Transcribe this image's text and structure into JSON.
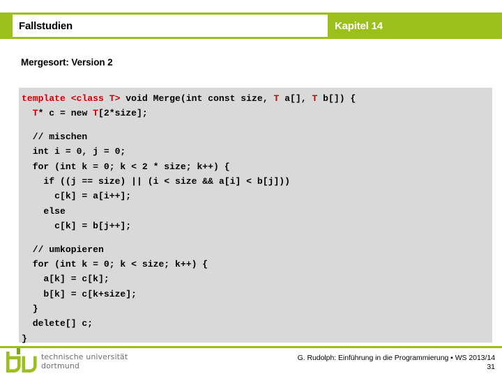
{
  "theme": {
    "accent_green": "#9BC01C",
    "code_background": "#D9D9D9",
    "keyword_red": "#D00000",
    "text_black": "#000000",
    "logo_gray": "#6E6E6E"
  },
  "header": {
    "title": "Fallstudien",
    "chapter": "Kapitel 14"
  },
  "subtitle": "Mergesort: Version 2",
  "code": {
    "lines": [
      [
        {
          "t": "template <class T>",
          "k": true
        },
        {
          "t": " void Merge(int const size, ",
          "k": false
        },
        {
          "t": "T",
          "k": true
        },
        {
          "t": " a[], ",
          "k": false
        },
        {
          "t": "T",
          "k": true
        },
        {
          "t": " b[]) {",
          "k": false
        }
      ],
      [
        {
          "t": "  ",
          "k": false
        },
        {
          "t": "T",
          "k": true
        },
        {
          "t": "* c = new ",
          "k": false
        },
        {
          "t": "T",
          "k": true
        },
        {
          "t": "[2*size];",
          "k": false
        }
      ],
      [],
      [
        {
          "t": "  // mischen",
          "k": false
        }
      ],
      [
        {
          "t": "  int i = 0, j = 0;",
          "k": false
        }
      ],
      [
        {
          "t": "  for (int k = 0; k < 2 * size; k++) {",
          "k": false
        }
      ],
      [
        {
          "t": "    if ((j == size) || (i < size && a[i] < b[j]))",
          "k": false
        }
      ],
      [
        {
          "t": "      c[k] = a[i++];",
          "k": false
        }
      ],
      [
        {
          "t": "    else",
          "k": false
        }
      ],
      [
        {
          "t": "      c[k] = b[j++];",
          "k": false
        }
      ],
      [],
      [
        {
          "t": "  // umkopieren",
          "k": false
        }
      ],
      [
        {
          "t": "  for (int k = 0; k < size; k++) {",
          "k": false
        }
      ],
      [
        {
          "t": "    a[k] = c[k];",
          "k": false
        }
      ],
      [
        {
          "t": "    b[k] = c[k+size];",
          "k": false
        }
      ],
      [
        {
          "t": "  }",
          "k": false
        }
      ],
      [
        {
          "t": "  delete[] c;",
          "k": false
        }
      ],
      [
        {
          "t": "}",
          "k": false
        }
      ]
    ]
  },
  "footer": {
    "logo_line1": "technische universität",
    "logo_line2": "dortmund",
    "attribution": "G. Rudolph: Einführung in die Programmierung ▪ WS 2013/14",
    "page_number": "31"
  }
}
